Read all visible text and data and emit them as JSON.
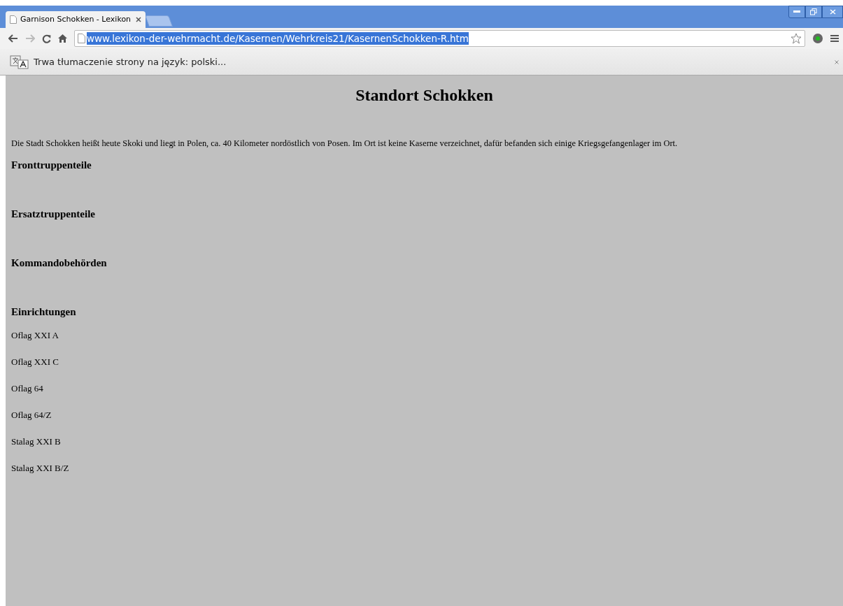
{
  "tabs": [
    {
      "title": "Garnison Schokken - Lexikon",
      "selected": true
    }
  ],
  "address_bar": {
    "url": "www.lexikon-der-wehrmacht.de/Kasernen/Wehrkreis21/KasernenSchokken-R.htm",
    "selected": true
  },
  "infobar": {
    "text": "Trwa tłumaczenie strony na język: polski..."
  },
  "page": {
    "title": "Standort Schokken",
    "intro": "Die Stadt Schokken heißt heute Skoki und liegt in Polen, ca. 40 Kilometer nordöstlich von Posen. Im Ort ist keine Kaserne verzeichnet, dafür befanden sich einige Kriegsgefangenlager im Ort.",
    "sections": [
      {
        "heading": "Fronttruppenteile"
      },
      {
        "heading": "Ersatztruppenteile"
      },
      {
        "heading": "Kommandobehörden"
      },
      {
        "heading": "Einrichtungen",
        "items": [
          "Oflag XXI A",
          "Oflag XXI C",
          "Oflag 64",
          "Oflag 64/Z",
          "Stalag XXI B",
          "Stalag XXI B/Z"
        ]
      }
    ]
  }
}
